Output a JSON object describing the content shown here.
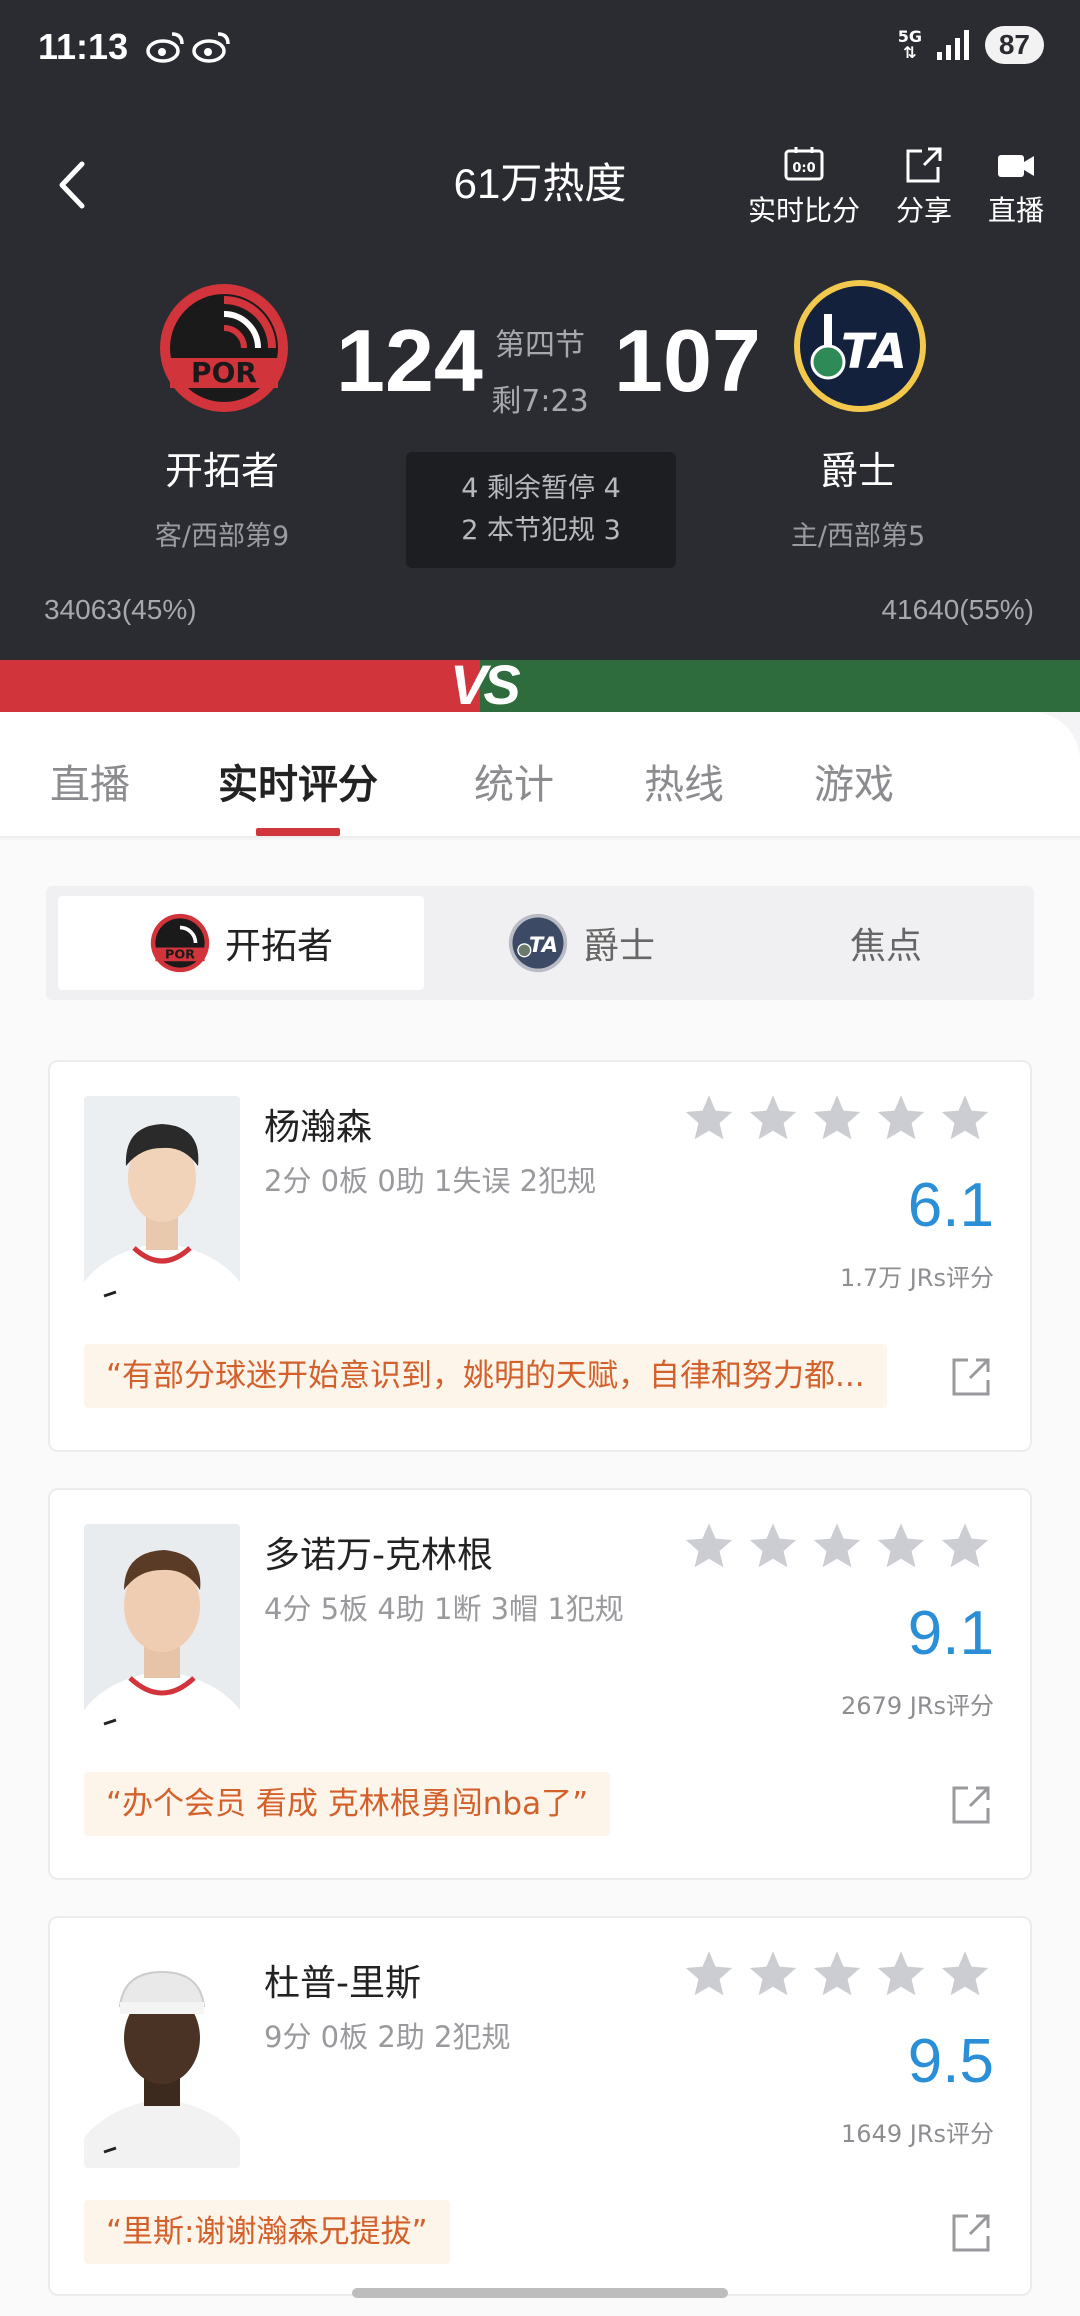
{
  "status_bar": {
    "time": "11:13",
    "network": "5G",
    "battery": "87"
  },
  "header": {
    "heat_title": "61万热度",
    "actions": [
      {
        "label": "实时比分",
        "icon": "scoreboard-icon"
      },
      {
        "label": "分享",
        "icon": "share-icon"
      },
      {
        "label": "直播",
        "icon": "video-camera-icon"
      }
    ]
  },
  "game": {
    "away": {
      "name": "开拓者",
      "rank": "客/西部第9",
      "score": "124",
      "votes": "34063(45%)",
      "logo_text": "POR",
      "color": "#d2343c"
    },
    "home": {
      "name": "爵士",
      "rank": "主/西部第5",
      "score": "107",
      "votes": "41640(55%)",
      "logo_text": "UTA",
      "color": "#2e6b3d"
    },
    "period": "第四节",
    "clock": "剩7:23",
    "timeouts_line": "4 剩余暂停 4",
    "fouls_line": "2 本节犯规 3",
    "vs": "VS"
  },
  "tabs": [
    "直播",
    "实时评分",
    "统计",
    "热线",
    "游戏"
  ],
  "segment": {
    "items": [
      "开拓者",
      "爵士",
      "焦点"
    ]
  },
  "players": [
    {
      "name": "杨瀚森",
      "stats": "2分 0板 0助 1失误 2犯规",
      "rating": "6.1",
      "count": "1.7万 JRs评分",
      "comment": "“有部分球迷开始意识到，姚明的天赋，自律和努力都...",
      "stars": 0
    },
    {
      "name": "多诺万-克林根",
      "stats": "4分 5板 4助 1断 3帽 1犯规",
      "rating": "9.1",
      "count": "2679 JRs评分",
      "comment": "“办个会员 看成 克林根勇闯nba了”",
      "stars": 0
    },
    {
      "name": "杜普-里斯",
      "stats": "9分 0板 2助 2犯规",
      "rating": "9.5",
      "count": "1649 JRs评分",
      "comment": "“里斯:谢谢瀚森兄提拔”",
      "stars": 0
    }
  ],
  "colors": {
    "accent_red": "#d2343c",
    "rating_blue": "#2a8fd6",
    "comment_orange": "#d3612c"
  }
}
